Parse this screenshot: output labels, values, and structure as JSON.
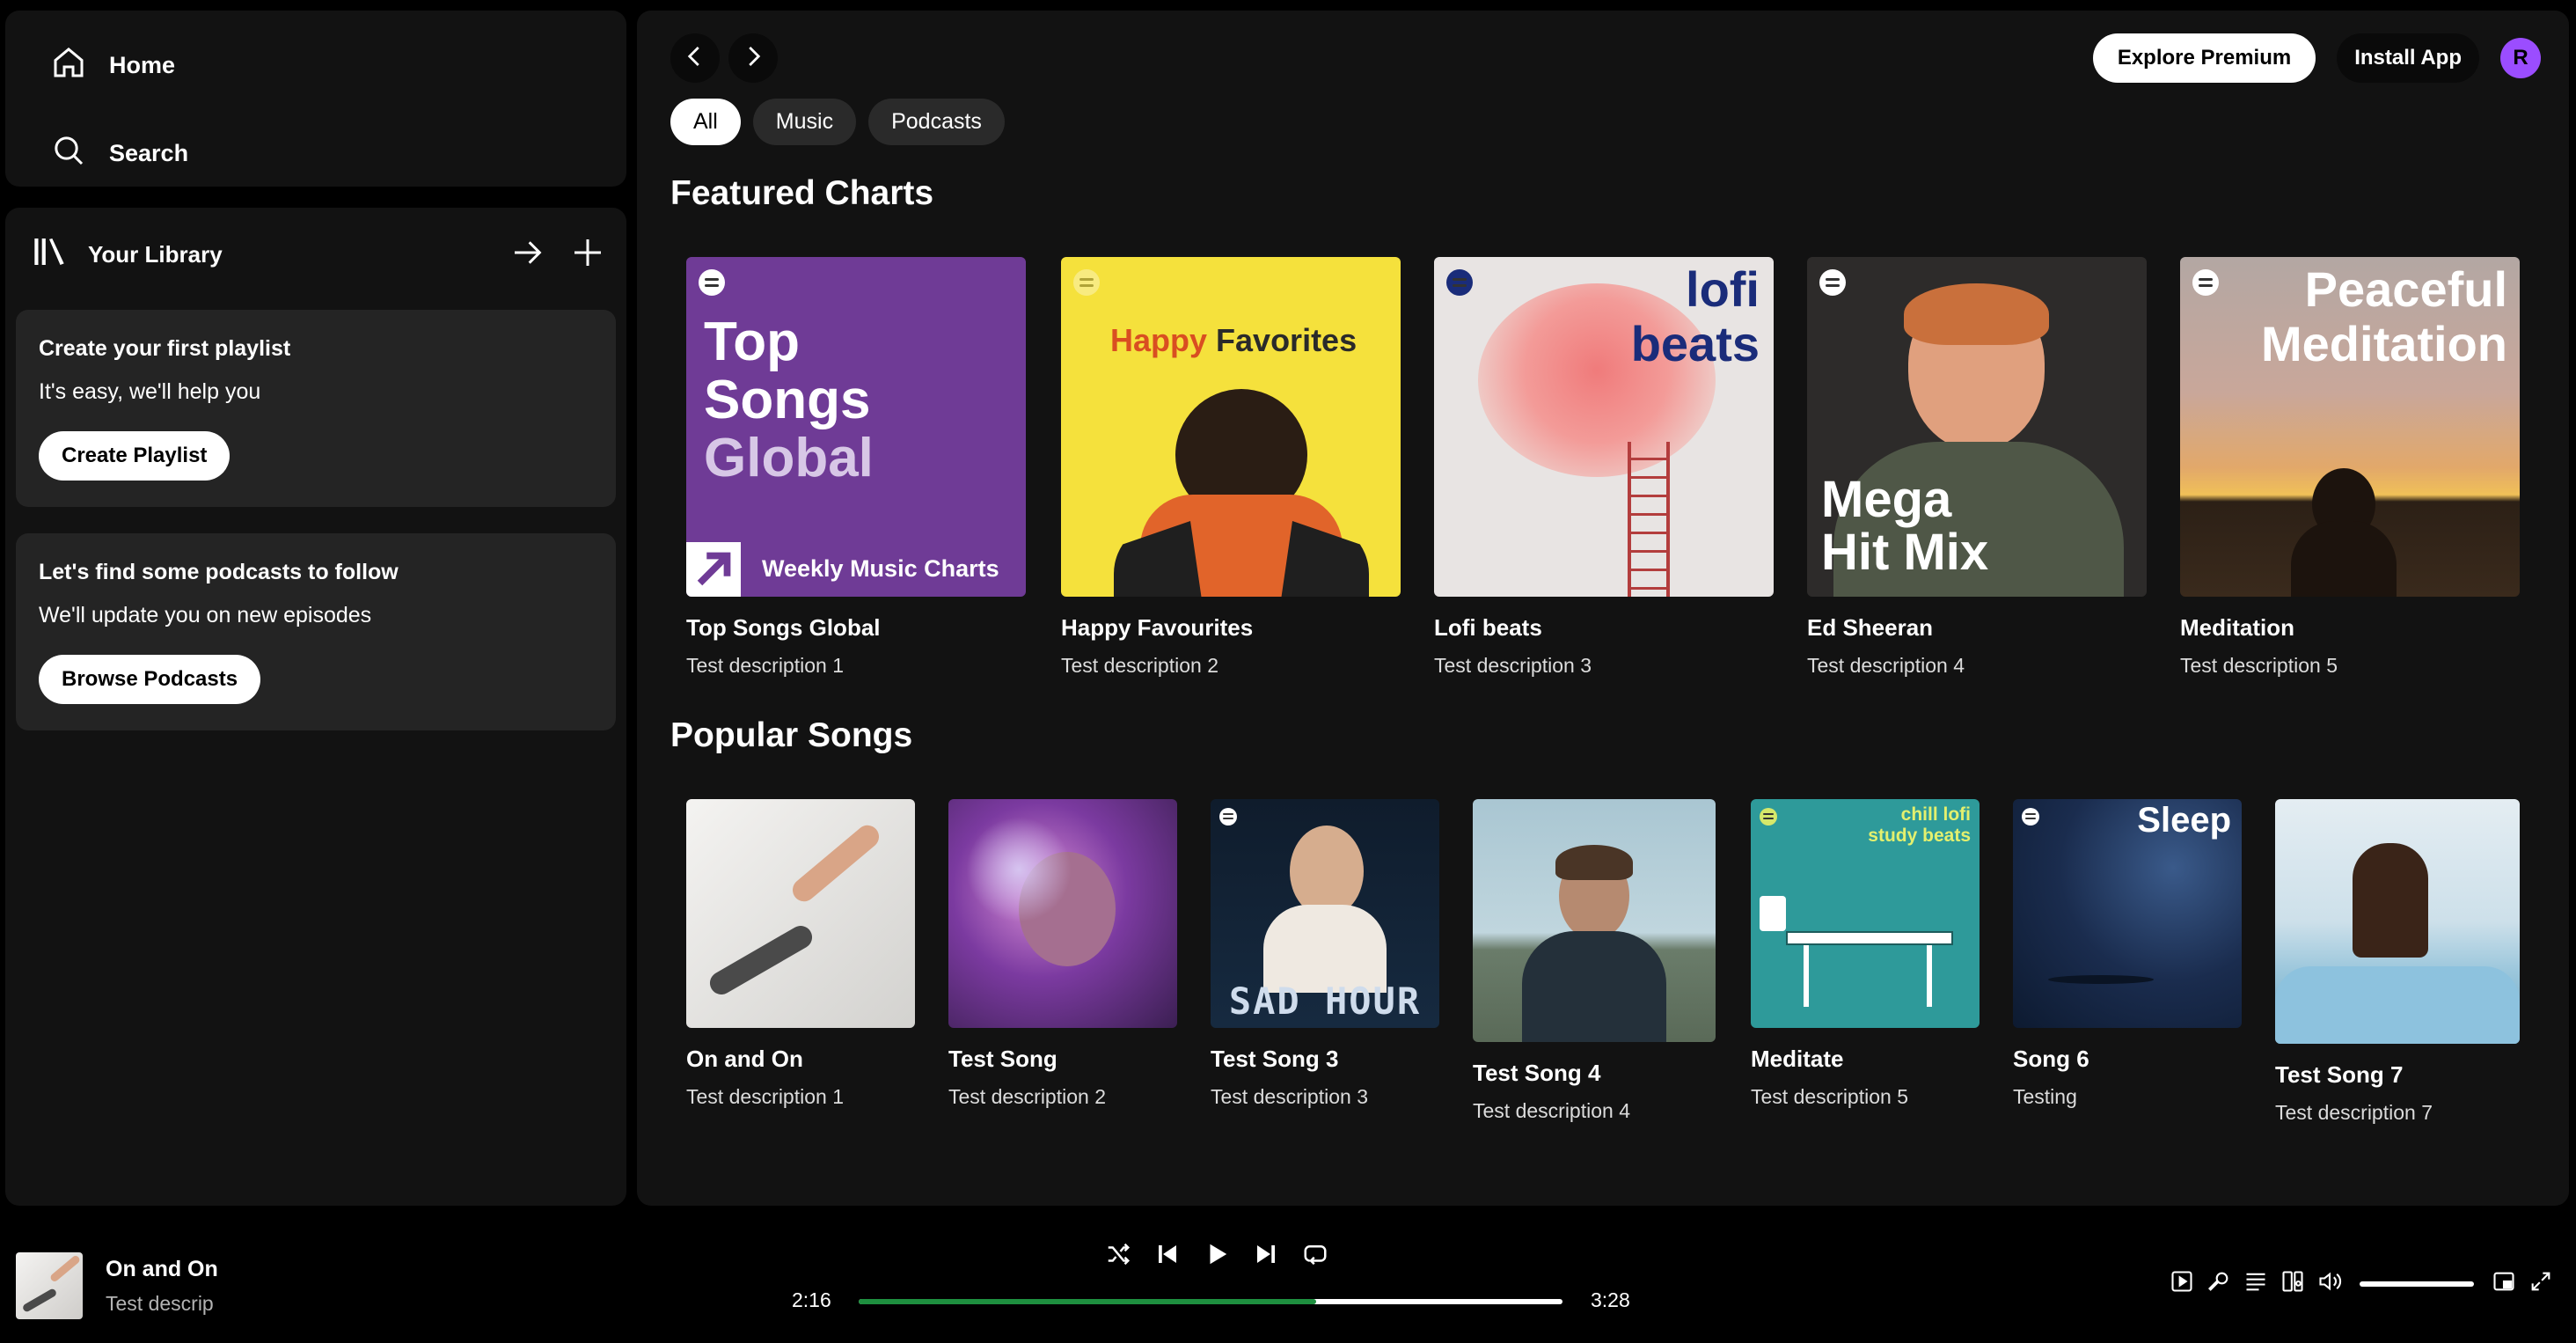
{
  "nav": {
    "home": "Home",
    "search": "Search"
  },
  "library": {
    "title": "Your Library",
    "playlist_card": {
      "title": "Create your first playlist",
      "subtitle": "It's easy, we'll help you",
      "button": "Create Playlist"
    },
    "podcast_card": {
      "title": "Let's find some podcasts to follow",
      "subtitle": "We'll update you on new episodes",
      "button": "Browse Podcasts"
    }
  },
  "header": {
    "explore_premium": "Explore Premium",
    "install_app": "Install App",
    "avatar_initial": "R"
  },
  "filters": [
    "All",
    "Music",
    "Podcasts"
  ],
  "active_filter": "All",
  "featured": {
    "title": "Featured Charts",
    "items": [
      {
        "title": "Top Songs Global",
        "desc": "Test description 1",
        "art_lines": [
          "Top",
          "Songs",
          "Global"
        ],
        "art_sub": "Weekly Music Charts",
        "bg": "#6f3b96"
      },
      {
        "title": "Happy Favourites",
        "desc": "Test description 2",
        "art_text_a": "Happy",
        "art_text_b": " Favorites",
        "bg": "#f5e13c"
      },
      {
        "title": "Lofi beats",
        "desc": "Test description 3",
        "art_lines": [
          "lofi",
          "beats"
        ],
        "bg": "#e8e4e3"
      },
      {
        "title": "Ed Sheeran",
        "desc": "Test description 4",
        "art_lines": [
          "Mega",
          "Hit Mix"
        ],
        "bg": "#2d2b2a"
      },
      {
        "title": "Meditation",
        "desc": "Test description 5",
        "art_lines": [
          "Peaceful",
          "Meditation"
        ],
        "bg": "#b6a8a4"
      }
    ]
  },
  "popular": {
    "title": "Popular Songs",
    "items": [
      {
        "title": "On and On",
        "desc": "Test description 1"
      },
      {
        "title": "Test Song",
        "desc": "Test description 2"
      },
      {
        "title": "Test Song 3",
        "desc": "Test description 3",
        "art_text": "SAD HOUR"
      },
      {
        "title": "Test Song 4",
        "desc": "Test description 4"
      },
      {
        "title": "Meditate",
        "desc": "Test description 5",
        "art_lines": [
          "chill lofi",
          "study beats"
        ]
      },
      {
        "title": "Song 6",
        "desc": "Testing",
        "art_text": "Sleep"
      },
      {
        "title": "Test Song 7",
        "desc": "Test description 7"
      }
    ]
  },
  "player": {
    "title": "On and On",
    "desc": "Test descrip",
    "elapsed": "2:16",
    "duration": "3:28",
    "progress": 0.65,
    "volume": 1.0
  },
  "colors": {
    "accent_green": "#1e8f3f",
    "avatar": "#9b4dff",
    "panel": "#121212",
    "card": "#242424"
  }
}
